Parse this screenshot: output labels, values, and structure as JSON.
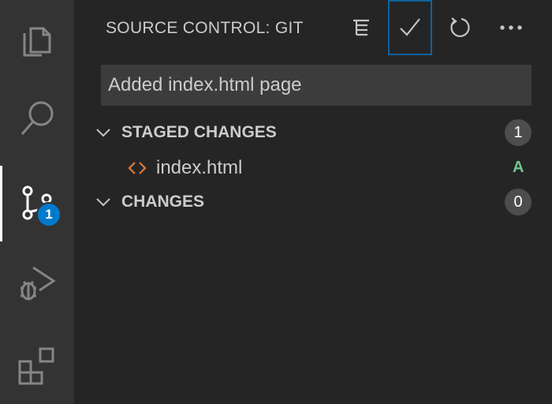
{
  "activity_bar": {
    "items": [
      {
        "name": "explorer",
        "icon": "files-icon"
      },
      {
        "name": "search",
        "icon": "search-icon"
      },
      {
        "name": "source-control",
        "icon": "source-control-icon",
        "active": true
      },
      {
        "name": "run-debug",
        "icon": "debug-icon"
      },
      {
        "name": "extensions",
        "icon": "extensions-icon"
      }
    ],
    "source_control_badge": "1"
  },
  "panel": {
    "title": "SOURCE CONTROL: GIT",
    "actions": [
      {
        "name": "view-as-tree",
        "icon": "list-tree-icon"
      },
      {
        "name": "commit",
        "icon": "check-icon"
      },
      {
        "name": "refresh",
        "icon": "refresh-icon"
      },
      {
        "name": "more-actions",
        "icon": "ellipsis-icon"
      }
    ]
  },
  "commit": {
    "message": "Added index.html page"
  },
  "groups": {
    "staged": {
      "label": "STAGED CHANGES",
      "count": "1",
      "files": [
        {
          "name": "index.html",
          "status": "A",
          "icon": "code-file-icon"
        }
      ]
    },
    "changes": {
      "label": "CHANGES",
      "count": "0"
    }
  },
  "colors": {
    "activity_bar_bg": "#333333",
    "panel_bg": "#252526",
    "input_bg": "#3c3c3c",
    "accent_blue": "#007acc",
    "added_status": "#73c991",
    "html_icon": "#e37933"
  }
}
